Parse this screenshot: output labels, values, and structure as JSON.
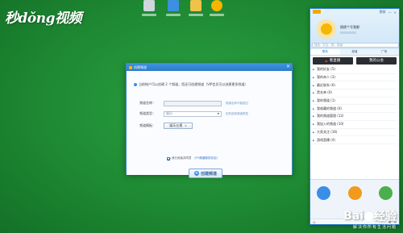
{
  "watermark": {
    "logo": "秒dǒng视频",
    "baidu_left": "Bai",
    "baidu_right": "经验",
    "baidu_slogan": "解决你所有生活问题"
  },
  "desktop_icons": [
    {
      "name": "recycle-bin-icon",
      "color": "#cfd6dc"
    },
    {
      "name": "network-icon",
      "color": "#3d8fe0"
    },
    {
      "name": "folder-icon",
      "color": "#f1c24a"
    },
    {
      "name": "yy-icon",
      "color": "#f7b500"
    }
  ],
  "dialog": {
    "title": "创建频道",
    "close": "×",
    "notice": "当前帐户可以创建 2 个频道，您还可创建频道（VIP会员可以创建更多频道）",
    "fields": {
      "name_label": "频道名称：",
      "name_hint": "频道名称不能超过",
      "type_label": "频道类型：",
      "type_value": "娱乐",
      "type_hint": "如何选择频道类型",
      "template_label": "频道模板：",
      "template_value": "娱乐五视"
    },
    "agree_text": "我已阅读并同意",
    "agree_link": "《YY频道服务协议》",
    "create_button": "创建频道"
  },
  "panel": {
    "top_links": [
      "换肤",
      "—",
      "×"
    ],
    "user_name": "随便个号我都",
    "search_placeholder": "搜索：好友、群、频道",
    "tabs": [
      "联系",
      "频道",
      "广场"
    ],
    "buttons": [
      "看直播",
      "我的公会"
    ],
    "items": [
      "我的好友 (5)",
      "我的亲人 (3)",
      "最近联系 (6)",
      "黑名单 (0)",
      "我的频道 (1)",
      "我收藏的频道 (0)",
      "我的频道管理 (12)",
      "我加入的频道 (10)",
      "大家关注 (16)",
      "游戏直播 (4)"
    ],
    "footer_circles": [
      {
        "name": "home-icon",
        "color": "#3a8ee6"
      },
      {
        "name": "user-icon",
        "color": "#f29a1c"
      },
      {
        "name": "group-icon",
        "color": "#4cae4f"
      }
    ],
    "status_mark": "◎"
  }
}
